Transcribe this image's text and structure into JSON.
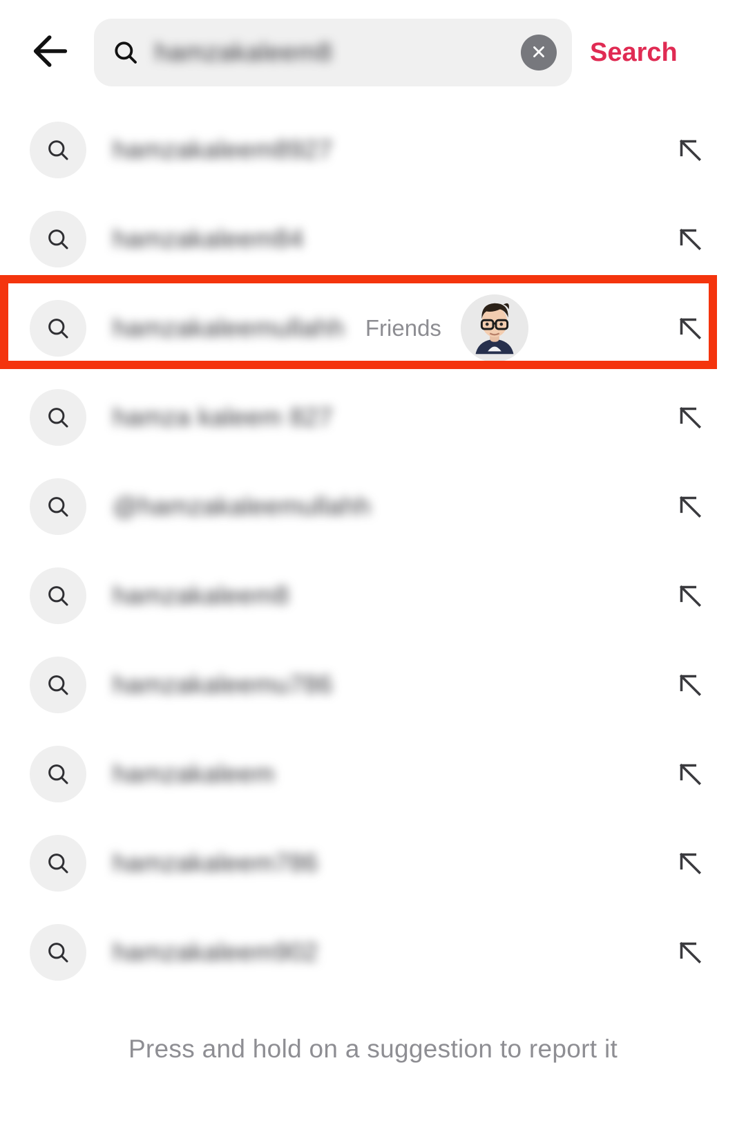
{
  "header": {
    "back_icon": "back-arrow-icon",
    "search_icon": "search-icon",
    "search_value": "hamzakaleem8",
    "search_placeholder": "Search",
    "clear_icon": "close-icon",
    "search_action_label": "Search",
    "search_action_color": "#e02b53"
  },
  "suggestions": {
    "rows": [
      {
        "icon": "search-icon",
        "label": "hamzakaleem8927",
        "meta": "",
        "avatar": false,
        "arrow_icon": "arrow-up-left-icon",
        "highlighted": false
      },
      {
        "icon": "search-icon",
        "label": "hamzakaleem84",
        "meta": "",
        "avatar": false,
        "arrow_icon": "arrow-up-left-icon",
        "highlighted": false
      },
      {
        "icon": "search-icon",
        "label": "hamzakaleemullahh",
        "meta": "Friends",
        "avatar": true,
        "arrow_icon": "arrow-up-left-icon",
        "highlighted": true
      },
      {
        "icon": "search-icon",
        "label": "hamza kaleem 827",
        "meta": "",
        "avatar": false,
        "arrow_icon": "arrow-up-left-icon",
        "highlighted": false
      },
      {
        "icon": "search-icon",
        "label": "@hamzakaleemullahh",
        "meta": "",
        "avatar": false,
        "arrow_icon": "arrow-up-left-icon",
        "highlighted": false
      },
      {
        "icon": "search-icon",
        "label": "hamzakaleem8",
        "meta": "",
        "avatar": false,
        "arrow_icon": "arrow-up-left-icon",
        "highlighted": false
      },
      {
        "icon": "search-icon",
        "label": "hamzakaleemu786",
        "meta": "",
        "avatar": false,
        "arrow_icon": "arrow-up-left-icon",
        "highlighted": false
      },
      {
        "icon": "search-icon",
        "label": "hamzakaleem",
        "meta": "",
        "avatar": false,
        "arrow_icon": "arrow-up-left-icon",
        "highlighted": false
      },
      {
        "icon": "search-icon",
        "label": "hamzakaleem786",
        "meta": "",
        "avatar": false,
        "arrow_icon": "arrow-up-left-icon",
        "highlighted": false
      },
      {
        "icon": "search-icon",
        "label": "hamzakaleem902",
        "meta": "",
        "avatar": false,
        "arrow_icon": "arrow-up-left-icon",
        "highlighted": false
      }
    ]
  },
  "highlight": {
    "color": "#f4340d"
  },
  "footer": {
    "hint": "Press and hold on a suggestion to report it"
  }
}
